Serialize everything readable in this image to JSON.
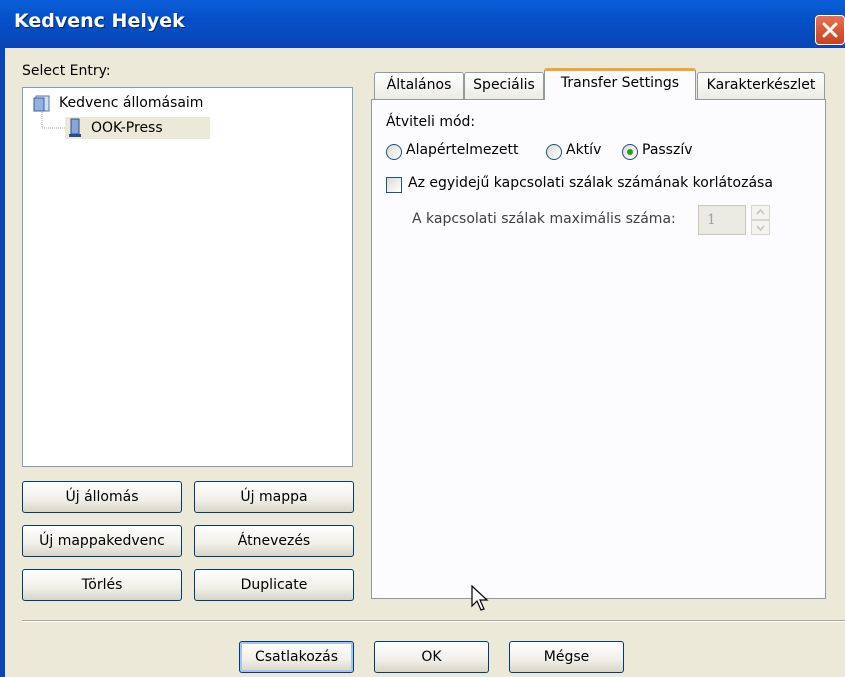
{
  "window": {
    "title": "Kedvenc Helyek"
  },
  "left": {
    "select_entry_label": "Select Entry:",
    "tree": {
      "root": "Kedvenc állomásaim",
      "child": "OOK-Press"
    },
    "buttons": {
      "new_station": "Új állomás",
      "new_folder": "Új mappa",
      "new_folder_favorite": "Új mappakedvenc",
      "rename": "Átnevezés",
      "delete": "Törlés",
      "duplicate": "Duplicate"
    }
  },
  "tabs": [
    {
      "label": "Általános",
      "active": false
    },
    {
      "label": "Speciális",
      "active": false
    },
    {
      "label": "Transfer Settings",
      "active": true
    },
    {
      "label": "Karakterkészlet",
      "active": false
    }
  ],
  "transfer": {
    "mode_label": "Átviteli mód:",
    "modes": [
      "Alapértelmezett",
      "Aktív",
      "Passzív"
    ],
    "selected_mode": "Passzív",
    "limit_checkbox_label": "Az egyidejű kapcsolati szálak számának korlátozása",
    "limit_checked": false,
    "max_threads_label": "A kapcsolati szálak maximális száma:",
    "max_threads_value": "1"
  },
  "footer": {
    "connect": "Csatlakozás",
    "ok": "OK",
    "cancel": "Mégse"
  },
  "colors": {
    "titlebar": "#0550c8",
    "active_tab_accent": "#f3a23a",
    "radio_selected": "#21a121"
  }
}
